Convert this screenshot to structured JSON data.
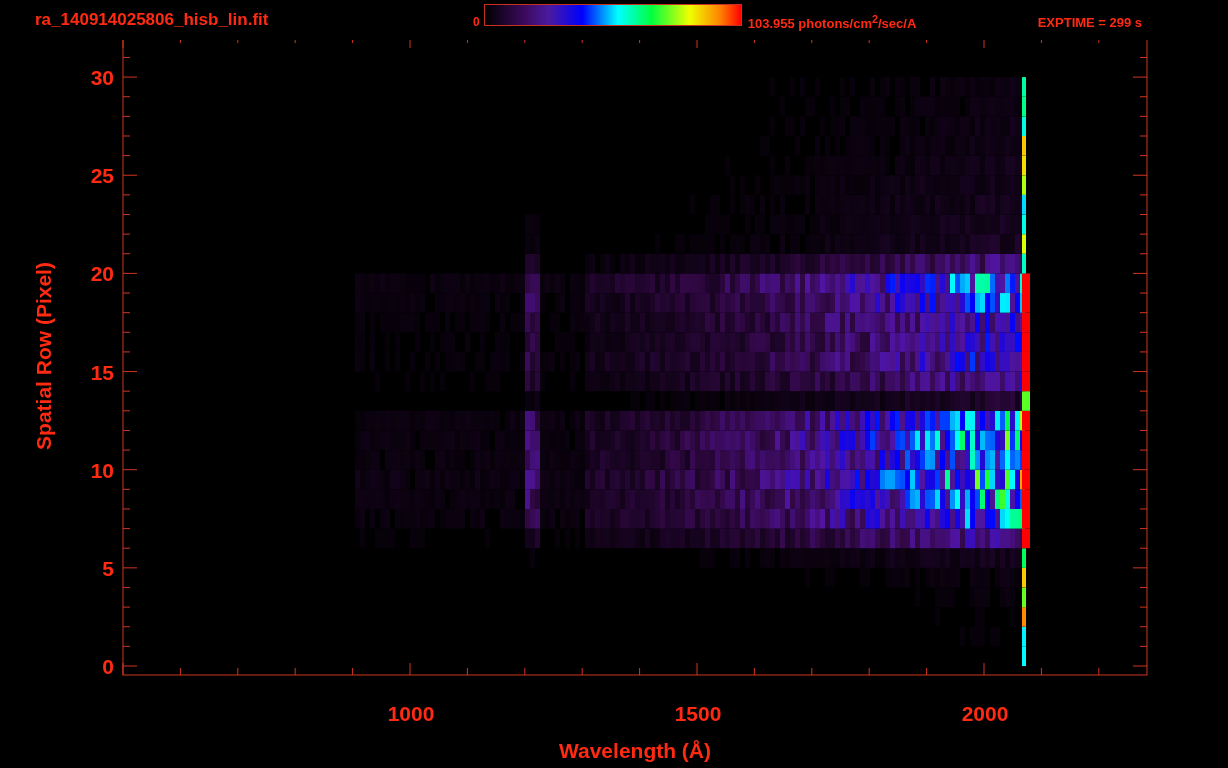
{
  "header": {
    "title": "ra_140914025806_hisb_lin.fit",
    "colorbar": {
      "min_label": "0",
      "max_label": "103.955 photons/cm$^{2}$/sec/A"
    },
    "exposure": "EXPTIME = 299 s"
  },
  "plot": {
    "x_axis": {
      "label": "Wavelength (Å)",
      "ticks": [
        "1000",
        "1500",
        "2000"
      ]
    },
    "y_axis": {
      "label": "Spatial Row (Pixel)",
      "ticks": [
        "30",
        "25",
        "20",
        "15",
        "10",
        "5",
        "0"
      ]
    }
  }
}
